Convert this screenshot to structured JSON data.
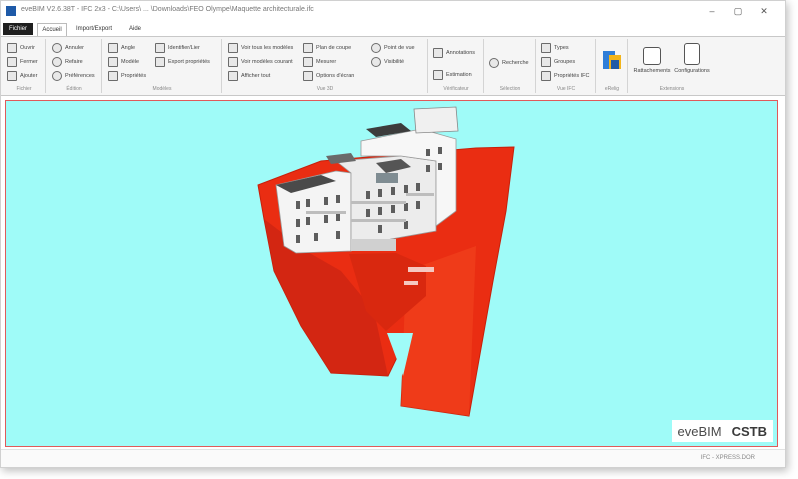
{
  "window": {
    "title": "eveBIM V2.6.38T - IFC 2x3 - C:\\Users\\ ... \\Downloads\\FEO Olympe\\Maquette architecturale.ifc",
    "controls": [
      "–",
      "▢",
      "✕"
    ]
  },
  "tabs": [
    {
      "label": "Fichier"
    },
    {
      "label": "Accueil"
    },
    {
      "label": "Import/Export"
    },
    {
      "label": "Aide"
    }
  ],
  "ribbon": {
    "groups": [
      {
        "label": "Fichier",
        "items": [
          "Ouvrir",
          "Fermer",
          "Ajouter"
        ]
      },
      {
        "label": "Édition",
        "items": [
          "Annuler",
          "Refaire",
          "Préférences"
        ]
      },
      {
        "label": "Modèles",
        "items": [
          "Angle",
          "Modèle",
          "Propriétés",
          "Identifier/Lier",
          "Export propriétés"
        ]
      },
      {
        "label": "Vue 3D",
        "items": [
          "Voir tous les modèles",
          "Voir modèles courant",
          "Afficher tout",
          "Plan de coupe",
          "Mesurer",
          "Options d'écran",
          "Point de vue",
          "Visibilité"
        ]
      },
      {
        "label": "Vérificateur",
        "items": [
          "Annotations",
          "Estimation"
        ]
      },
      {
        "label": "Sélection",
        "items": [
          "Recherche"
        ]
      },
      {
        "label": "Vue IFC",
        "items": [
          "Types",
          "Groupes",
          "Propriétés IFC"
        ]
      },
      {
        "label": "eRelig",
        "items": []
      },
      {
        "label": "Extensions",
        "items": [
          "Rattachements",
          "Configurations"
        ]
      }
    ]
  },
  "viewport": {
    "background": "#9ffbf8",
    "terrain_color": "#ea2d12",
    "building_color": "#f2f2f2"
  },
  "brand": {
    "product": "eveBIM",
    "company": "CSTB"
  },
  "statusbar": {
    "text": "IFC - XPRESS.DOR"
  }
}
